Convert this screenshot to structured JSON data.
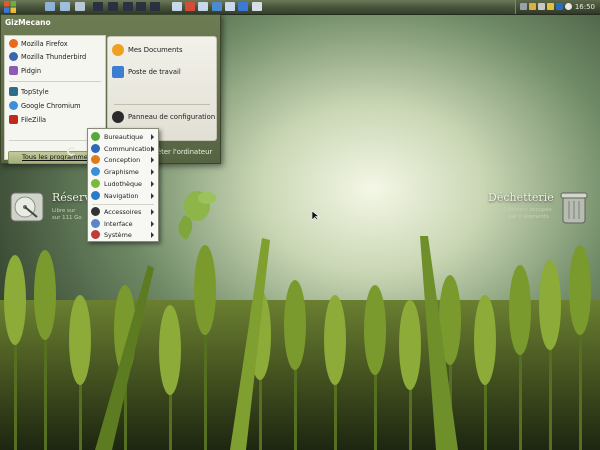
{
  "start_menu": {
    "user_name": "GizMecano",
    "pinned": [
      {
        "label": "Mozilla Firefox",
        "icon": "firefox-icon",
        "color": "#e66a1a"
      },
      {
        "label": "Mozilla Thunderbird",
        "icon": "thunderbird-icon",
        "color": "#3a66b0"
      },
      {
        "label": "Pidgin",
        "icon": "pidgin-icon",
        "color": "#8c5bb5"
      }
    ],
    "recent": [
      {
        "label": "TopStyle",
        "icon": "topstyle-icon",
        "color": "#2e6c8c"
      },
      {
        "label": "Google Chromium",
        "icon": "chromium-icon",
        "color": "#3b8fd8"
      },
      {
        "label": "FileZilla",
        "icon": "filezilla-icon",
        "color": "#c02a1e"
      }
    ],
    "all_programs_label": "Tous les programmes",
    "right_items": [
      {
        "label": "Mes Documents",
        "icon": "documents-icon",
        "color": "#f0a020"
      },
      {
        "label": "Poste de travail",
        "icon": "computer-icon",
        "color": "#3c7fd0"
      },
      {
        "label": "Panneau de configuration",
        "icon": "control-panel-icon",
        "color": "#2b2b2b"
      }
    ],
    "shutdown_label": "Arrêter l'ordinateur"
  },
  "programs_submenu": [
    {
      "label": "Bureautique",
      "icon": "office-icon",
      "color": "#58a838",
      "group": 1
    },
    {
      "label": "Communication",
      "icon": "communication-icon",
      "color": "#2f67b8",
      "group": 1
    },
    {
      "label": "Conception",
      "icon": "design-icon",
      "color": "#e07b1a",
      "group": 1
    },
    {
      "label": "Graphisme",
      "icon": "graphics-icon",
      "color": "#3b8fd8",
      "group": 1
    },
    {
      "label": "Ludothèque",
      "icon": "games-icon",
      "color": "#7cb83a",
      "group": 1
    },
    {
      "label": "Navigation",
      "icon": "internet-icon",
      "color": "#2a7acb",
      "group": 1
    },
    {
      "label": "Accessoires",
      "icon": "accessories-icon",
      "color": "#333333",
      "group": 2
    },
    {
      "label": "Interface",
      "icon": "interface-icon",
      "color": "#5a86c8",
      "group": 2
    },
    {
      "label": "Système",
      "icon": "system-icon",
      "color": "#c03a3a",
      "group": 2
    }
  ],
  "desktop": {
    "drive": {
      "title": "Réserve",
      "line1": "Libre sur",
      "line2": "sur 111 Go",
      "icon": "hard-drive-icon"
    },
    "trash": {
      "title": "Déchetterie",
      "line1": "0 fichiers occupés",
      "line2": "par 0 éléments",
      "icon": "trash-icon"
    }
  },
  "taskbar": {
    "clock": "16:50",
    "start_icon": "windows-logo-icon"
  },
  "colors": {
    "taskbar": "#46523a",
    "menu_frame": "#6e7c54",
    "highlight": "#a3b07a"
  }
}
